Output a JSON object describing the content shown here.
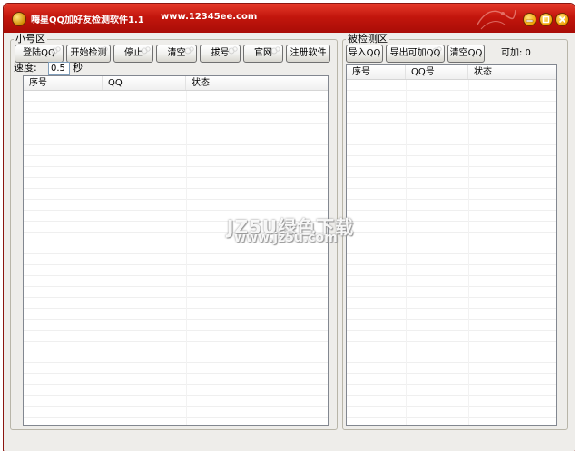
{
  "window": {
    "title": "嗨星QQ加好友检测软件1.1",
    "url": "www.12345ee.com",
    "controls": {
      "minimize": "minimize-icon",
      "restore": "restore-icon",
      "close": "close-icon"
    }
  },
  "left_panel": {
    "group_label": "小号区",
    "buttons": [
      "登陆QQ",
      "开始检测",
      "停止",
      "清空",
      "拔号",
      "官网",
      "注册软件"
    ],
    "speed_label": "速度:",
    "speed_value": "0.5",
    "speed_unit": "秒",
    "columns": [
      "序号",
      "QQ",
      "状态"
    ]
  },
  "right_panel": {
    "group_label": "被检测区",
    "buttons": [
      "导入QQ",
      "导出可加QQ",
      "清空QQ"
    ],
    "count_label": "可加: 0",
    "columns": [
      "序号",
      "QQ号",
      "状态"
    ]
  },
  "watermark": {
    "main": "JZ5U绿色下载",
    "sub": "www.jz5u.com"
  },
  "colors": {
    "titlebar": "#c3160d",
    "window_bg": "#eeedea",
    "list_border": "#828790"
  }
}
